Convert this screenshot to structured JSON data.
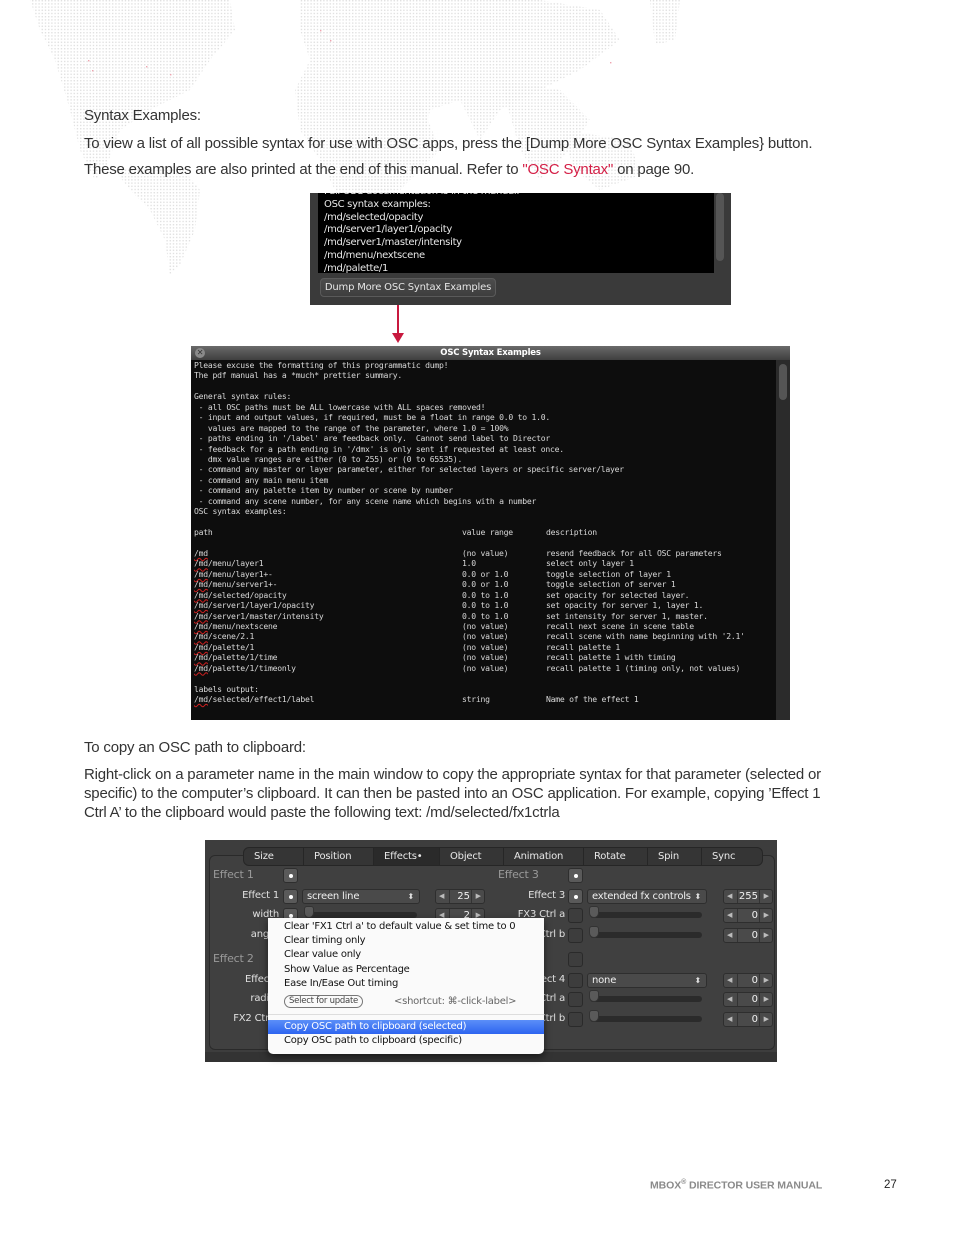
{
  "page": {
    "heading_syntax": "Syntax Examples:",
    "para1": "To view a list of all possible syntax for use with OSC apps, press the [Dump More OSC Syntax Examples} button.",
    "para2_prefix": "These examples are also printed at the end of this manual. Refer to ",
    "para2_link": "\"OSC Syntax\"",
    "para2_suffix": " on page 90.",
    "heading_copy": "To copy an OSC path to clipboard:",
    "para3_line1": "Right-click on a parameter name in the main window to copy the appropriate syntax for that parameter (selected or",
    "para3_line2": "specific) to the computer’s clipboard. It can then be pasted into an OSC application. For example, copying ’Effect 1",
    "para3_line3": "Ctrl A’ to the clipboard would paste the following text: /md/selected/fx1ctrla",
    "footer_brand": "MBOX",
    "footer_reg": "®",
    "footer_title": " DIRECTOR USER MANUAL",
    "page_number": "27",
    "link_color": "#d41f46"
  },
  "shot1": {
    "cut_line": "Full OSC documentation is in the manual.",
    "lines": [
      "OSC syntax examples:",
      "/md/selected/opacity",
      "/md/server1/layer1/opacity",
      "/md/server1/master/intensity",
      "/md/menu/nextscene",
      "/md/palette/1"
    ],
    "button": "Dump More OSC Syntax Examples"
  },
  "shot2": {
    "title": "OSC Syntax Examples",
    "intro": [
      "Please excuse the formatting of this programmatic dump!",
      "The pdf manual has a *much* prettier summary.",
      "",
      "General syntax rules:",
      " - all OSC paths must be ALL lowercase with ALL spaces removed!",
      " - input and output values, if required, must be a float in range 0.0 to 1.0.",
      "   values are mapped to the range of the parameter, where 1.0 = 100%",
      " - paths ending in '/label' are feedback only.  Cannot send label to Director",
      " - feedback for a path ending in '/dmx' is only sent if requested at least once.",
      "   dmx value ranges are either (0 to 255) or (0 to 65535).",
      " - command any master or layer parameter, either for selected layers or specific server/layer",
      " - command any main menu item",
      " - command any palette item by number or scene by number",
      " - command any scene number, for any scene name which begins with a number",
      "OSC syntax examples:",
      ""
    ],
    "header": [
      "path",
      "value range",
      "description"
    ],
    "rows": [
      [
        "/md",
        "(no value)",
        "resend feedback for all OSC parameters"
      ],
      [
        "/md/menu/layer1",
        "1.0",
        "select only layer 1"
      ],
      [
        "/md/menu/layer1+-",
        "0.0 or 1.0",
        "toggle selection of layer 1"
      ],
      [
        "/md/menu/server1+-",
        "0.0 or 1.0",
        "toggle selection of server 1"
      ],
      [
        "/md/selected/opacity",
        "0.0 to 1.0",
        "set opacity for selected layer."
      ],
      [
        "/md/server1/layer1/opacity",
        "0.0 to 1.0",
        "set opacity for server 1, layer 1."
      ],
      [
        "/md/server1/master/intensity",
        "0.0 to 1.0",
        "set intensity for server 1, master."
      ],
      [
        "/md/menu/nextscene",
        "(no value)",
        "recall next scene in scene table"
      ],
      [
        "/md/scene/2.1",
        "(no value)",
        "recall scene with name beginning with '2.1'"
      ],
      [
        "/md/palette/1",
        "(no value)",
        "recall palette 1"
      ],
      [
        "/md/palette/1/time",
        "(no value)",
        "recall palette 1 with timing"
      ],
      [
        "/md/palette/1/timeonly",
        "(no value)",
        "recall palette 1 (timing only, not values)"
      ]
    ],
    "labels_heading": "labels output:",
    "label_row": [
      "/md/selected/effect1/label",
      "string",
      "Name of the effect 1"
    ]
  },
  "shot3": {
    "tabs": [
      "Size",
      "Position",
      "Effects•",
      "Object",
      "Animation",
      "Rotate",
      "Spin",
      "Sync"
    ],
    "active_tab": "Effects•",
    "left": {
      "section1": "Effect 1",
      "effect1_label": "Effect 1",
      "effect1_value": "screen line",
      "effect1_num": "25",
      "width_label": "width",
      "width_num": "2",
      "angle_label": "ang",
      "section2": "Effect 2",
      "effect2_label": "Effec",
      "radius_label": "radi",
      "fx2_label": "FX2 Ctr"
    },
    "right": {
      "section3": "Effect 3",
      "effect3_label": "Effect 3",
      "effect3_value": "extended fx controls",
      "effect3_num": "255",
      "fx3a_label": "FX3 Ctrl a",
      "fx3a_num": "0",
      "fx3b_label": "Ctrl b",
      "fx3b_num": "0",
      "effect4_label": "ect 4",
      "effect4_value": "none",
      "effect4_num": "0",
      "fx4a_label": "Ctrl a",
      "fx4a_num": "0",
      "fx4b_label": "Ctrl b",
      "fx4b_num": "0"
    },
    "menu": {
      "items": [
        "Clear 'FX1 Ctrl a' to default value & set time to 0",
        "Clear timing only",
        "Clear value only",
        "Show Value as Percentage",
        "Ease In/Ease Out timing"
      ],
      "select_for_update": "Select for update",
      "shortcut": "<shortcut: ⌘-click-label>",
      "copy_selected": "Copy OSC path to clipboard (selected)",
      "copy_specific": "Copy OSC path to clipboard (specific)",
      "highlight_color": "#3a6ff2"
    }
  }
}
